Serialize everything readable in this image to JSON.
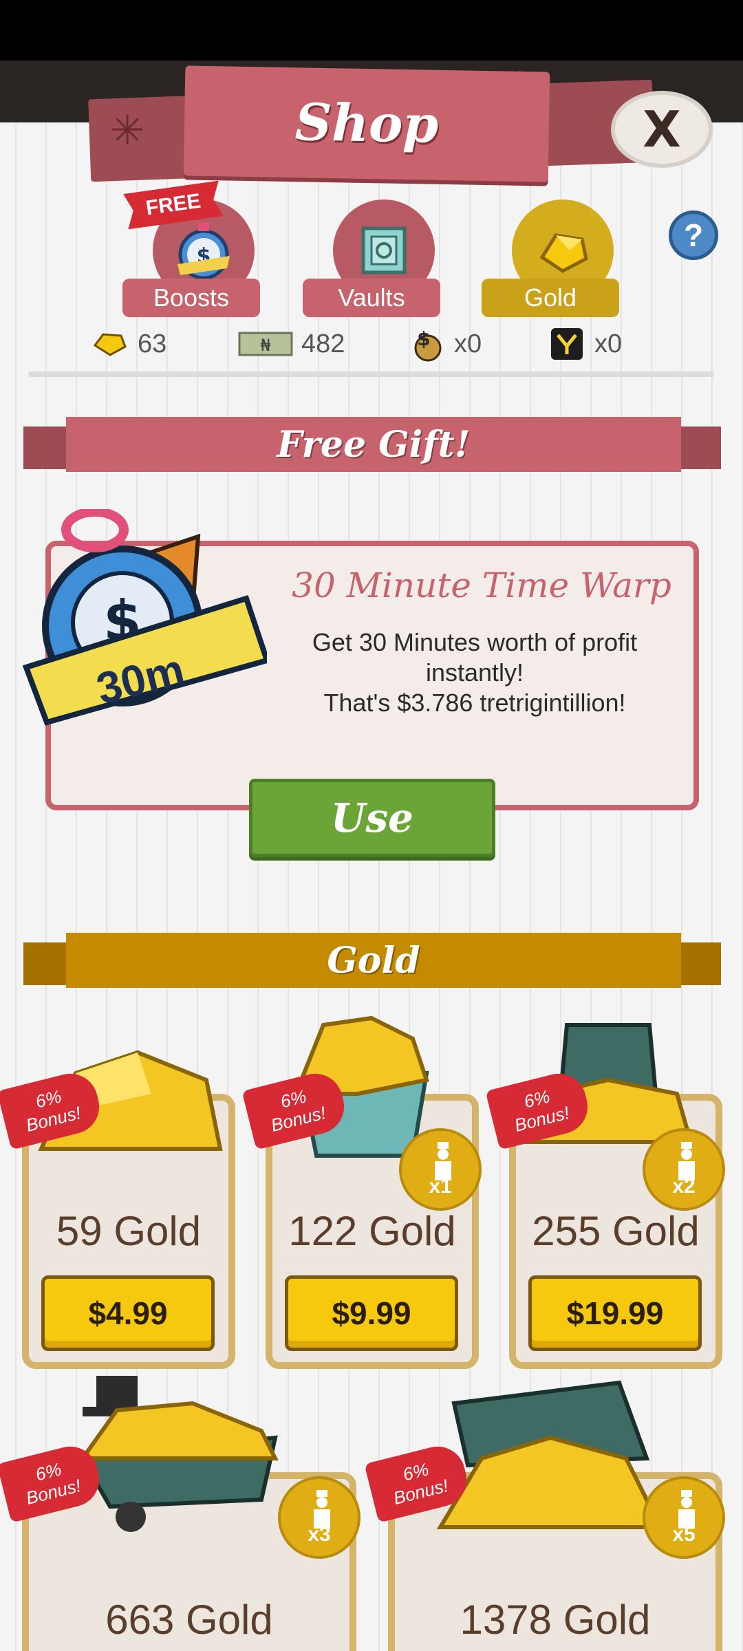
{
  "header": {
    "title": "Shop",
    "close_label": "X"
  },
  "tabs": [
    {
      "label": "Boosts",
      "badge": "FREE"
    },
    {
      "label": "Vaults"
    },
    {
      "label": "Gold"
    }
  ],
  "help_label": "?",
  "currencies": [
    {
      "icon": "gold-gem-icon",
      "value": "63"
    },
    {
      "icon": "megabucks-icon",
      "value": "482"
    },
    {
      "icon": "money-bag-icon",
      "value": "x0"
    },
    {
      "icon": "angel-investor-icon",
      "value": "x0"
    }
  ],
  "free_gift": {
    "banner": "Free Gift!",
    "badge": "30m",
    "title": "30 Minute Time Warp",
    "desc_line1": "Get 30 Minutes worth of profit",
    "desc_line2": "instantly!",
    "desc_line3": "That's $3.786 tretrigintillion!",
    "use_label": "Use"
  },
  "gold_section": {
    "banner": "Gold",
    "items": [
      {
        "amount": "59 Gold",
        "price": "$4.99",
        "bonus_pct": "6%",
        "bonus_word": "Bonus!",
        "multiplier": ""
      },
      {
        "amount": "122 Gold",
        "price": "$9.99",
        "bonus_pct": "6%",
        "bonus_word": "Bonus!",
        "multiplier": "x1"
      },
      {
        "amount": "255 Gold",
        "price": "$19.99",
        "bonus_pct": "6%",
        "bonus_word": "Bonus!",
        "multiplier": "x2"
      },
      {
        "amount": "663 Gold",
        "price": "",
        "bonus_pct": "6%",
        "bonus_word": "Bonus!",
        "multiplier": "x3"
      },
      {
        "amount": "1378 Gold",
        "price": "",
        "bonus_pct": "6%",
        "bonus_word": "Bonus!",
        "multiplier": "x5"
      }
    ]
  },
  "colors": {
    "rose": "#c6636c",
    "gold_banner": "#c48a00",
    "green_button": "#6ba437",
    "price_yellow": "#f6c90e"
  }
}
